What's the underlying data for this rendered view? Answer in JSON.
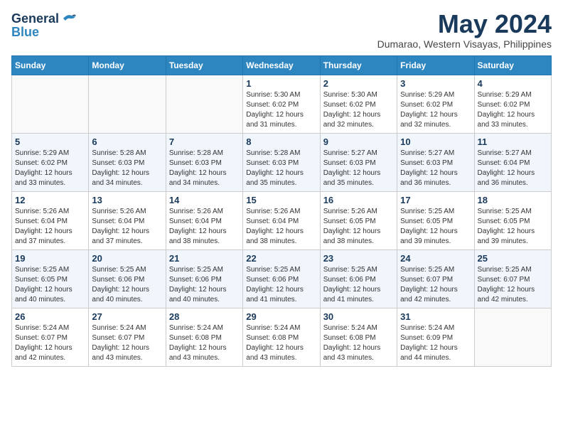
{
  "header": {
    "logo_line1": "General",
    "logo_line2": "Blue",
    "month_title": "May 2024",
    "location": "Dumarao, Western Visayas, Philippines"
  },
  "weekdays": [
    "Sunday",
    "Monday",
    "Tuesday",
    "Wednesday",
    "Thursday",
    "Friday",
    "Saturday"
  ],
  "weeks": [
    [
      {
        "day": "",
        "info": ""
      },
      {
        "day": "",
        "info": ""
      },
      {
        "day": "",
        "info": ""
      },
      {
        "day": "1",
        "info": "Sunrise: 5:30 AM\nSunset: 6:02 PM\nDaylight: 12 hours\nand 31 minutes."
      },
      {
        "day": "2",
        "info": "Sunrise: 5:30 AM\nSunset: 6:02 PM\nDaylight: 12 hours\nand 32 minutes."
      },
      {
        "day": "3",
        "info": "Sunrise: 5:29 AM\nSunset: 6:02 PM\nDaylight: 12 hours\nand 32 minutes."
      },
      {
        "day": "4",
        "info": "Sunrise: 5:29 AM\nSunset: 6:02 PM\nDaylight: 12 hours\nand 33 minutes."
      }
    ],
    [
      {
        "day": "5",
        "info": "Sunrise: 5:29 AM\nSunset: 6:02 PM\nDaylight: 12 hours\nand 33 minutes."
      },
      {
        "day": "6",
        "info": "Sunrise: 5:28 AM\nSunset: 6:03 PM\nDaylight: 12 hours\nand 34 minutes."
      },
      {
        "day": "7",
        "info": "Sunrise: 5:28 AM\nSunset: 6:03 PM\nDaylight: 12 hours\nand 34 minutes."
      },
      {
        "day": "8",
        "info": "Sunrise: 5:28 AM\nSunset: 6:03 PM\nDaylight: 12 hours\nand 35 minutes."
      },
      {
        "day": "9",
        "info": "Sunrise: 5:27 AM\nSunset: 6:03 PM\nDaylight: 12 hours\nand 35 minutes."
      },
      {
        "day": "10",
        "info": "Sunrise: 5:27 AM\nSunset: 6:03 PM\nDaylight: 12 hours\nand 36 minutes."
      },
      {
        "day": "11",
        "info": "Sunrise: 5:27 AM\nSunset: 6:04 PM\nDaylight: 12 hours\nand 36 minutes."
      }
    ],
    [
      {
        "day": "12",
        "info": "Sunrise: 5:26 AM\nSunset: 6:04 PM\nDaylight: 12 hours\nand 37 minutes."
      },
      {
        "day": "13",
        "info": "Sunrise: 5:26 AM\nSunset: 6:04 PM\nDaylight: 12 hours\nand 37 minutes."
      },
      {
        "day": "14",
        "info": "Sunrise: 5:26 AM\nSunset: 6:04 PM\nDaylight: 12 hours\nand 38 minutes."
      },
      {
        "day": "15",
        "info": "Sunrise: 5:26 AM\nSunset: 6:04 PM\nDaylight: 12 hours\nand 38 minutes."
      },
      {
        "day": "16",
        "info": "Sunrise: 5:26 AM\nSunset: 6:05 PM\nDaylight: 12 hours\nand 38 minutes."
      },
      {
        "day": "17",
        "info": "Sunrise: 5:25 AM\nSunset: 6:05 PM\nDaylight: 12 hours\nand 39 minutes."
      },
      {
        "day": "18",
        "info": "Sunrise: 5:25 AM\nSunset: 6:05 PM\nDaylight: 12 hours\nand 39 minutes."
      }
    ],
    [
      {
        "day": "19",
        "info": "Sunrise: 5:25 AM\nSunset: 6:05 PM\nDaylight: 12 hours\nand 40 minutes."
      },
      {
        "day": "20",
        "info": "Sunrise: 5:25 AM\nSunset: 6:06 PM\nDaylight: 12 hours\nand 40 minutes."
      },
      {
        "day": "21",
        "info": "Sunrise: 5:25 AM\nSunset: 6:06 PM\nDaylight: 12 hours\nand 40 minutes."
      },
      {
        "day": "22",
        "info": "Sunrise: 5:25 AM\nSunset: 6:06 PM\nDaylight: 12 hours\nand 41 minutes."
      },
      {
        "day": "23",
        "info": "Sunrise: 5:25 AM\nSunset: 6:06 PM\nDaylight: 12 hours\nand 41 minutes."
      },
      {
        "day": "24",
        "info": "Sunrise: 5:25 AM\nSunset: 6:07 PM\nDaylight: 12 hours\nand 42 minutes."
      },
      {
        "day": "25",
        "info": "Sunrise: 5:25 AM\nSunset: 6:07 PM\nDaylight: 12 hours\nand 42 minutes."
      }
    ],
    [
      {
        "day": "26",
        "info": "Sunrise: 5:24 AM\nSunset: 6:07 PM\nDaylight: 12 hours\nand 42 minutes."
      },
      {
        "day": "27",
        "info": "Sunrise: 5:24 AM\nSunset: 6:07 PM\nDaylight: 12 hours\nand 43 minutes."
      },
      {
        "day": "28",
        "info": "Sunrise: 5:24 AM\nSunset: 6:08 PM\nDaylight: 12 hours\nand 43 minutes."
      },
      {
        "day": "29",
        "info": "Sunrise: 5:24 AM\nSunset: 6:08 PM\nDaylight: 12 hours\nand 43 minutes."
      },
      {
        "day": "30",
        "info": "Sunrise: 5:24 AM\nSunset: 6:08 PM\nDaylight: 12 hours\nand 43 minutes."
      },
      {
        "day": "31",
        "info": "Sunrise: 5:24 AM\nSunset: 6:09 PM\nDaylight: 12 hours\nand 44 minutes."
      },
      {
        "day": "",
        "info": ""
      }
    ]
  ]
}
